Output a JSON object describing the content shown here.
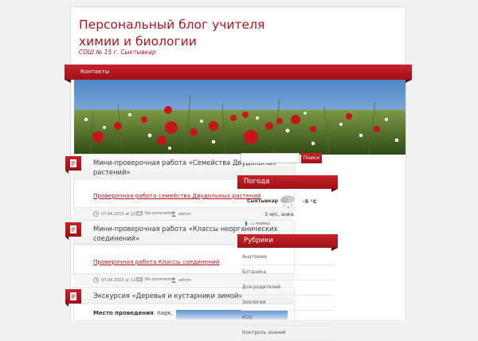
{
  "site": {
    "title": "Персональный блог учителя химии и биологии",
    "description": "СОШ № 15 г. Сыктывкар"
  },
  "nav": {
    "items": [
      {
        "label": "Контакты"
      }
    ]
  },
  "posts": [
    {
      "title": "Мини-проверочная работа «Семейства Двудольных растений»",
      "link": "Проверочная работа семейства Двудольных растений",
      "date": "07.04.2015 at 12:17",
      "comments": "No comments",
      "author": "admin"
    },
    {
      "title": "Мини-проверочная работа «Классы неорганических соединений»",
      "link": "Проверочная работа Классы соединений",
      "date": "07.04.2015 at 12:10",
      "comments": "No comments",
      "author": "admin"
    },
    {
      "title": "Экскурсия «Деревья и кустарники зимой»",
      "place_label": "Место проведения",
      "place_value": ": парк,"
    }
  ],
  "search": {
    "button_label": "Поиск"
  },
  "weather": {
    "title": "Погода",
    "city": "Сыктывкар",
    "temperature": "-5 °C",
    "wind": "3 м/с, южн.",
    "provider": "meteo",
    "provider_prefix": "ua"
  },
  "categories": {
    "title": "Рубрики",
    "items": [
      "Анатомия",
      "Ботаника",
      "Для родителей",
      "Зоология",
      "КОЗ",
      "Контроль знаний"
    ]
  },
  "colors": {
    "accent": "#b3131b",
    "accent_dark": "#9d1016"
  }
}
